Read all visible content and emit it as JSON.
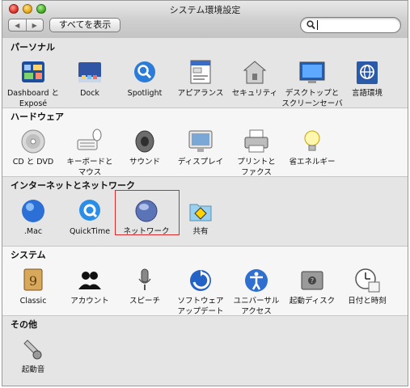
{
  "window": {
    "title": "システム環境設定"
  },
  "toolbar": {
    "back_glyph": "◀",
    "forward_glyph": "▶",
    "show_all_label": "すべてを表示",
    "search": {
      "value": "",
      "placeholder": ""
    }
  },
  "sections": [
    {
      "title": "パーソナル",
      "items": [
        {
          "label": "Dashboard と\nExposé",
          "icon": "dashboard-icon"
        },
        {
          "label": "Dock",
          "icon": "dock-icon"
        },
        {
          "label": "Spotlight",
          "icon": "spotlight-icon"
        },
        {
          "label": "アピアランス",
          "icon": "appearance-icon"
        },
        {
          "label": "セキュリティ",
          "icon": "security-icon"
        },
        {
          "label": "デスクトップと\nスクリーンセーバ",
          "icon": "desktop-screensaver-icon"
        },
        {
          "label": "言語環境",
          "icon": "international-icon"
        }
      ]
    },
    {
      "title": "ハードウェア",
      "items": [
        {
          "label": "CD と DVD",
          "icon": "cd-dvd-icon"
        },
        {
          "label": "キーボードと\nマウス",
          "icon": "keyboard-mouse-icon"
        },
        {
          "label": "サウンド",
          "icon": "sound-icon"
        },
        {
          "label": "ディスプレイ",
          "icon": "displays-icon"
        },
        {
          "label": "プリントと\nファクス",
          "icon": "print-fax-icon"
        },
        {
          "label": "省エネルギー",
          "icon": "energy-saver-icon"
        }
      ]
    },
    {
      "title": "インターネットとネットワーク",
      "items": [
        {
          "label": ".Mac",
          "icon": "dotmac-icon"
        },
        {
          "label": "QuickTime",
          "icon": "quicktime-icon"
        },
        {
          "label": "ネットワーク",
          "icon": "network-icon"
        },
        {
          "label": "共有",
          "icon": "sharing-icon"
        }
      ]
    },
    {
      "title": "システム",
      "items": [
        {
          "label": "Classic",
          "icon": "classic-icon"
        },
        {
          "label": "アカウント",
          "icon": "accounts-icon"
        },
        {
          "label": "スピーチ",
          "icon": "speech-icon"
        },
        {
          "label": "ソフトウェア\nアップデート",
          "icon": "software-update-icon"
        },
        {
          "label": "ユニバーサル\nアクセス",
          "icon": "universal-access-icon"
        },
        {
          "label": "起動ディスク",
          "icon": "startup-disk-icon"
        },
        {
          "label": "日付と時刻",
          "icon": "date-time-icon"
        }
      ]
    },
    {
      "title": "その他",
      "items": [
        {
          "label": "起動音",
          "icon": "startup-sound-icon"
        }
      ]
    }
  ],
  "highlighted_item": "ネットワーク"
}
